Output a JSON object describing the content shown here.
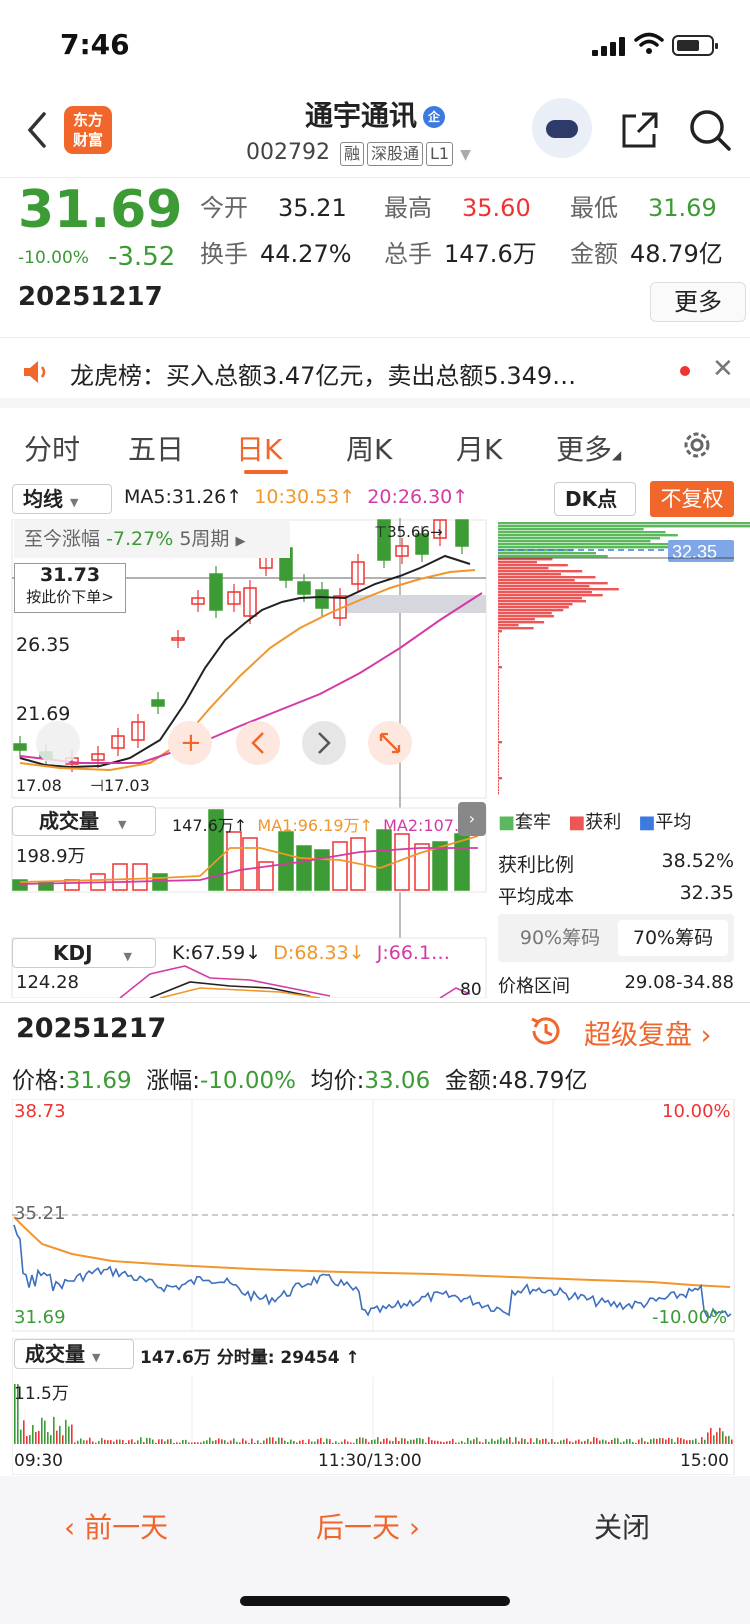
{
  "status": {
    "time": "7:46"
  },
  "header": {
    "logo_text_1": "东方",
    "logo_text_2": "财富",
    "title": "通宇通讯",
    "title_badge": "企",
    "code": "002792",
    "tags": [
      "融",
      "深股通",
      "L1"
    ]
  },
  "quote": {
    "price": "31.69",
    "change_pct": "-10.00%",
    "change": "-3.52",
    "date": "20251217",
    "open_label": "今开",
    "open": "35.21",
    "high_label": "最高",
    "high": "35.60",
    "low_label": "最低",
    "low": "31.69",
    "turnover_label": "换手",
    "turnover": "44.27%",
    "volume_label": "总手",
    "volume": "147.6万",
    "amount_label": "金额",
    "amount": "48.79亿",
    "more_button": "更多"
  },
  "notice": {
    "text": "龙虎榜：买入总额3.47亿元，卖出总额5.349…"
  },
  "tabs": [
    "分时",
    "五日",
    "日K",
    "周K",
    "月K",
    "更多"
  ],
  "kline": {
    "ma_select": "均线",
    "ma5": "MA5:31.26↑",
    "ma10": "10:30.53↑",
    "ma20": "20:26.30↑",
    "dk_button": "DK点",
    "fq_button": "不复权",
    "period_label": "至今涨幅",
    "period_value": "-7.27%",
    "period_days": "5周期",
    "order_price": "31.73",
    "order_label": "按此价下单>",
    "y_labels": [
      "26.35",
      "21.69"
    ],
    "low_mark": "17.03",
    "low_left": "17.08",
    "high_mark": "35.66",
    "chip_price": "32.35"
  },
  "volume_panel": {
    "select": "成交量",
    "vol": "147.6万↑",
    "ma1": "MA1:96.19万↑",
    "ma2": "MA2:107.6…",
    "max": "198.9万"
  },
  "kdj_panel": {
    "select": "KDJ",
    "k": "K:67.59↓",
    "d": "D:68.33↓",
    "j": "J:66.1…",
    "max": "124.28",
    "level": "80"
  },
  "chips": {
    "legend": [
      "套牢",
      "获利",
      "平均"
    ],
    "profit_label": "获利比例",
    "profit": "38.52%",
    "avgcost_label": "平均成本",
    "avgcost": "32.35",
    "tab90": "90%筹码",
    "tab70": "70%筹码",
    "range_label": "价格区间",
    "range": "29.08-34.88"
  },
  "intraday": {
    "date": "20251217",
    "replay": "超级复盘",
    "price_label": "价格:",
    "price": "31.69",
    "chg_label": "涨幅:",
    "chg": "-10.00%",
    "avg_label": "均价:",
    "avg": "33.06",
    "amt_label": "金额:",
    "amt": "48.79亿",
    "y_top": "38.73",
    "y_mid": "35.21",
    "y_bot": "31.69",
    "pct_top": "10.00%",
    "pct_bot": "-10.00%",
    "vol_select": "成交量",
    "vol_text": "147.6万 分时量: 29454 ↑",
    "vol_max": "11.5万",
    "times": [
      "09:30",
      "11:30/13:00",
      "15:00"
    ]
  },
  "bottom": {
    "prev": "前一天",
    "next": "后一天",
    "close": "关闭"
  },
  "colors": {
    "red": "#e33333",
    "green": "#3d9b35",
    "orange": "#f0962b",
    "pink": "#d43aa5",
    "accent": "#f0662b"
  }
}
